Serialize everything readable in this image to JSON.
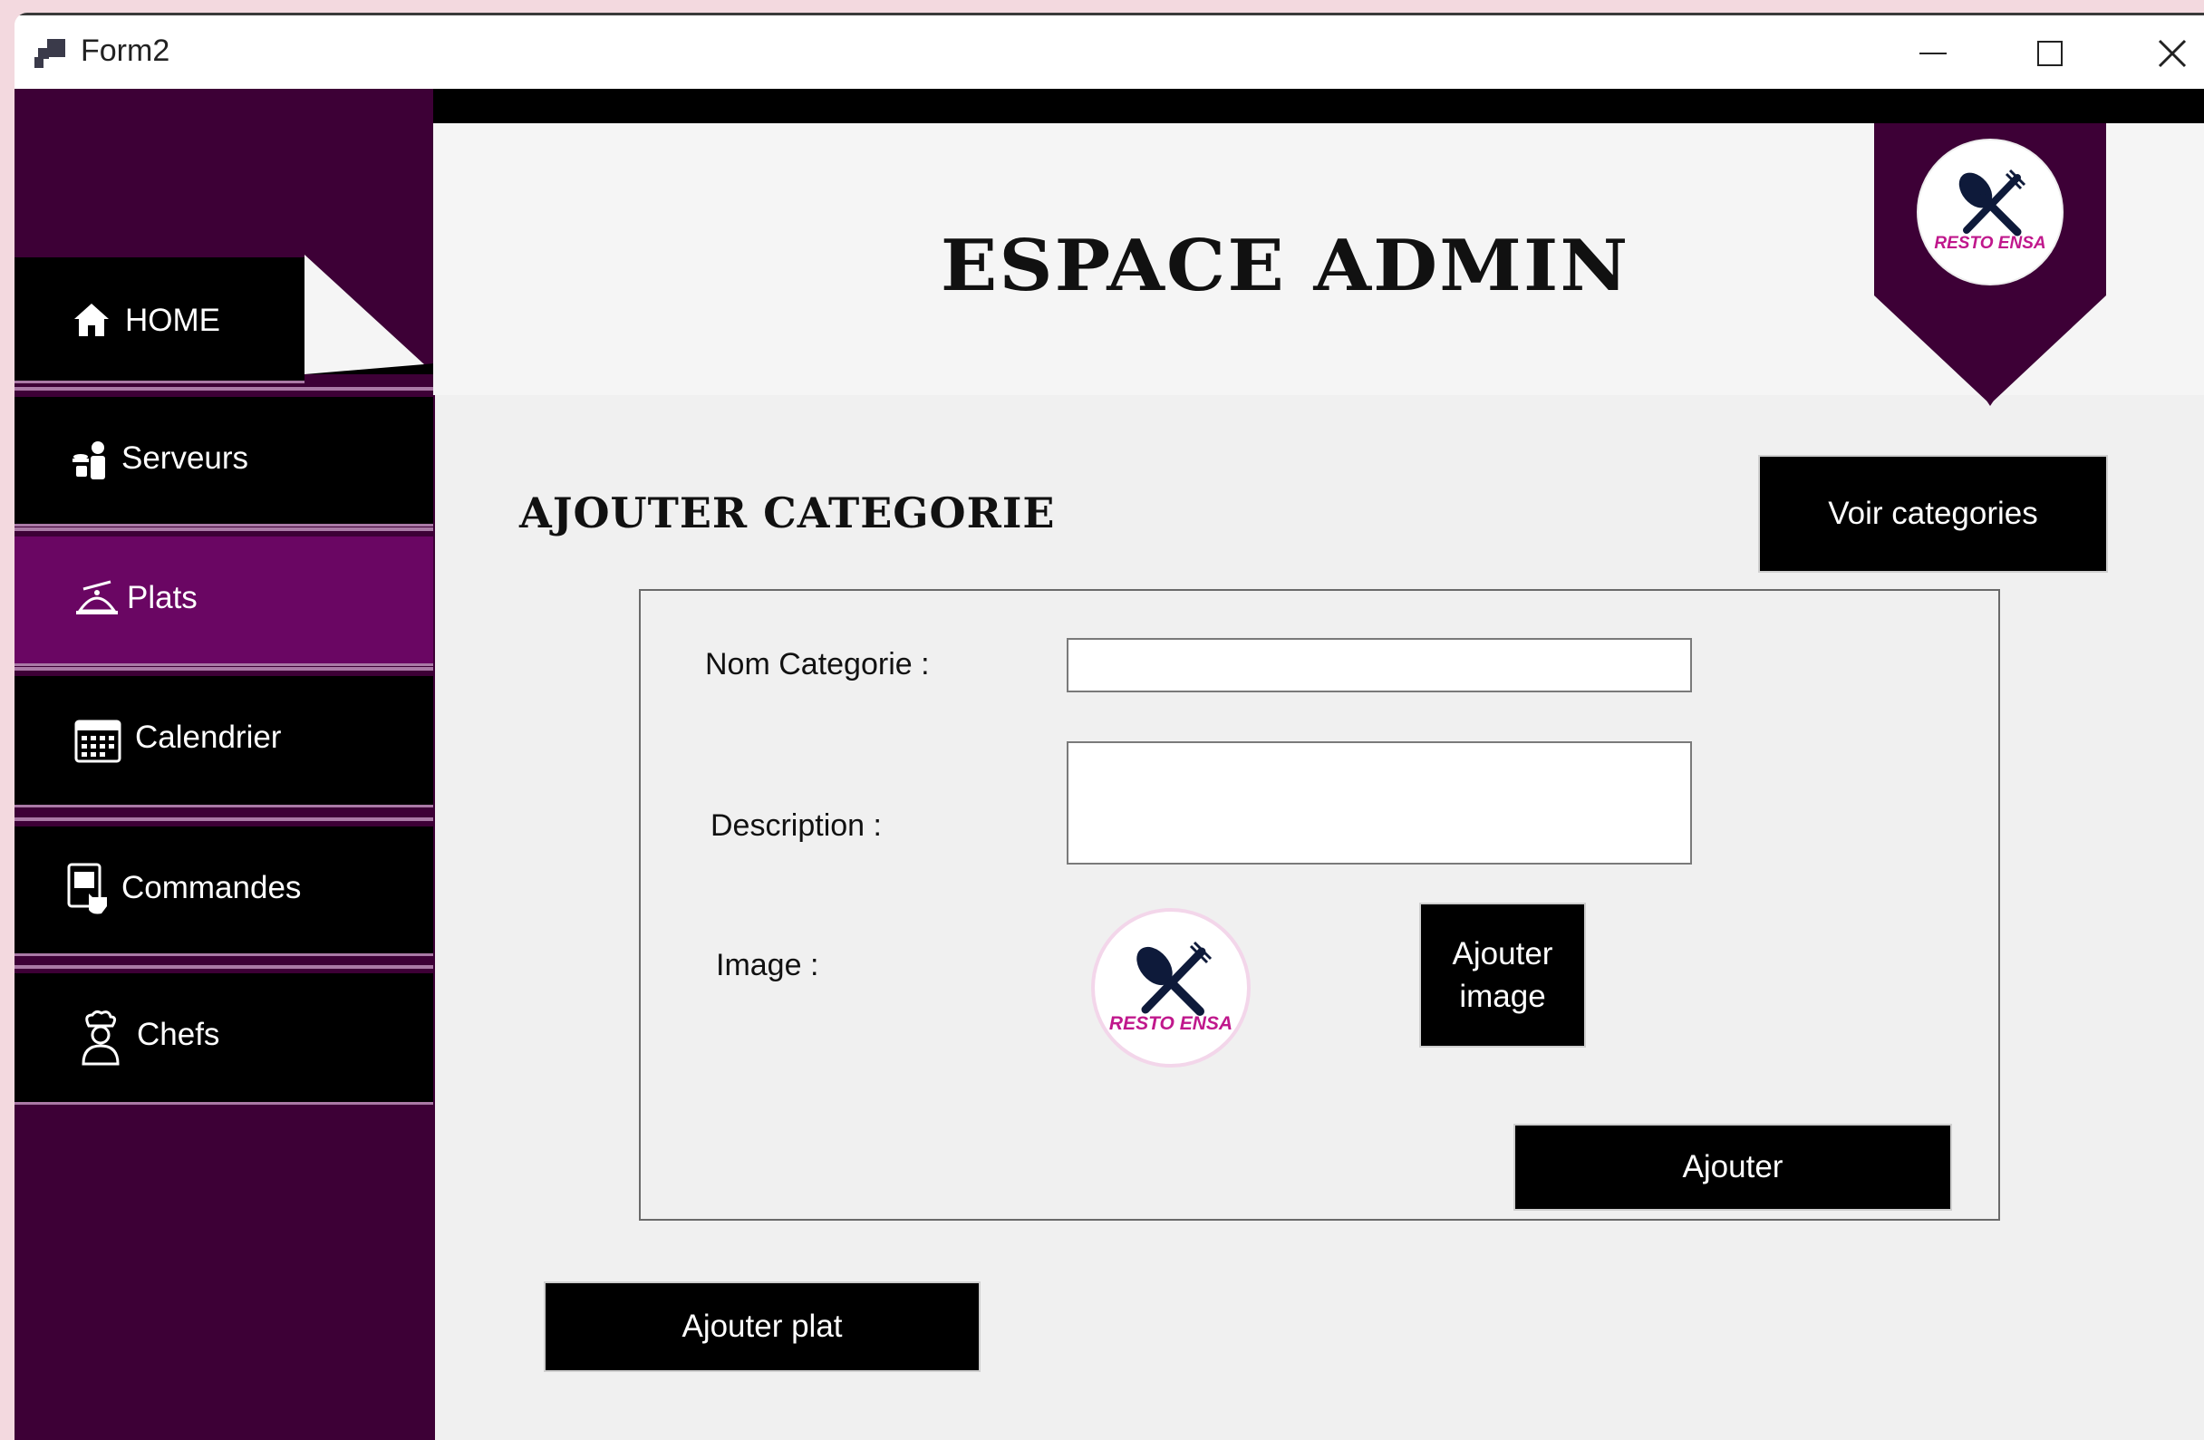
{
  "window": {
    "title": "Form2"
  },
  "sidebar": {
    "items": [
      {
        "id": "home",
        "label": "HOME",
        "icon": "home-icon",
        "active": false
      },
      {
        "id": "serveurs",
        "label": "Serveurs",
        "icon": "waiter-icon",
        "active": false
      },
      {
        "id": "plats",
        "label": "Plats",
        "icon": "serving-dish-icon",
        "active": true
      },
      {
        "id": "calendrier",
        "label": "Calendrier",
        "icon": "calendar-icon",
        "active": false
      },
      {
        "id": "commandes",
        "label": "Commandes",
        "icon": "tablet-order-icon",
        "active": false
      },
      {
        "id": "chefs",
        "label": "Chefs",
        "icon": "chef-icon",
        "active": false
      }
    ]
  },
  "header": {
    "title": "ESPACE ADMIN",
    "logo_text": "RESTO ENSA"
  },
  "main": {
    "section_title": "AJOUTER CATEGORIE",
    "voir_button": "Voir categories",
    "form": {
      "nom_label": "Nom Categorie :",
      "nom_value": "",
      "description_label": "Description :",
      "description_value": "",
      "image_label": "Image :",
      "image_logo_text": "RESTO ENSA",
      "ajouter_image_button": "Ajouter image",
      "ajouter_button": "Ajouter"
    },
    "ajouter_plat_button": "Ajouter plat"
  },
  "colors": {
    "sidebar_bg": "#3d0036",
    "active_item": "#6a0663",
    "accent_separator": "#aa7aa6",
    "button_bg": "#000000",
    "logo_pink": "#c0188c"
  }
}
